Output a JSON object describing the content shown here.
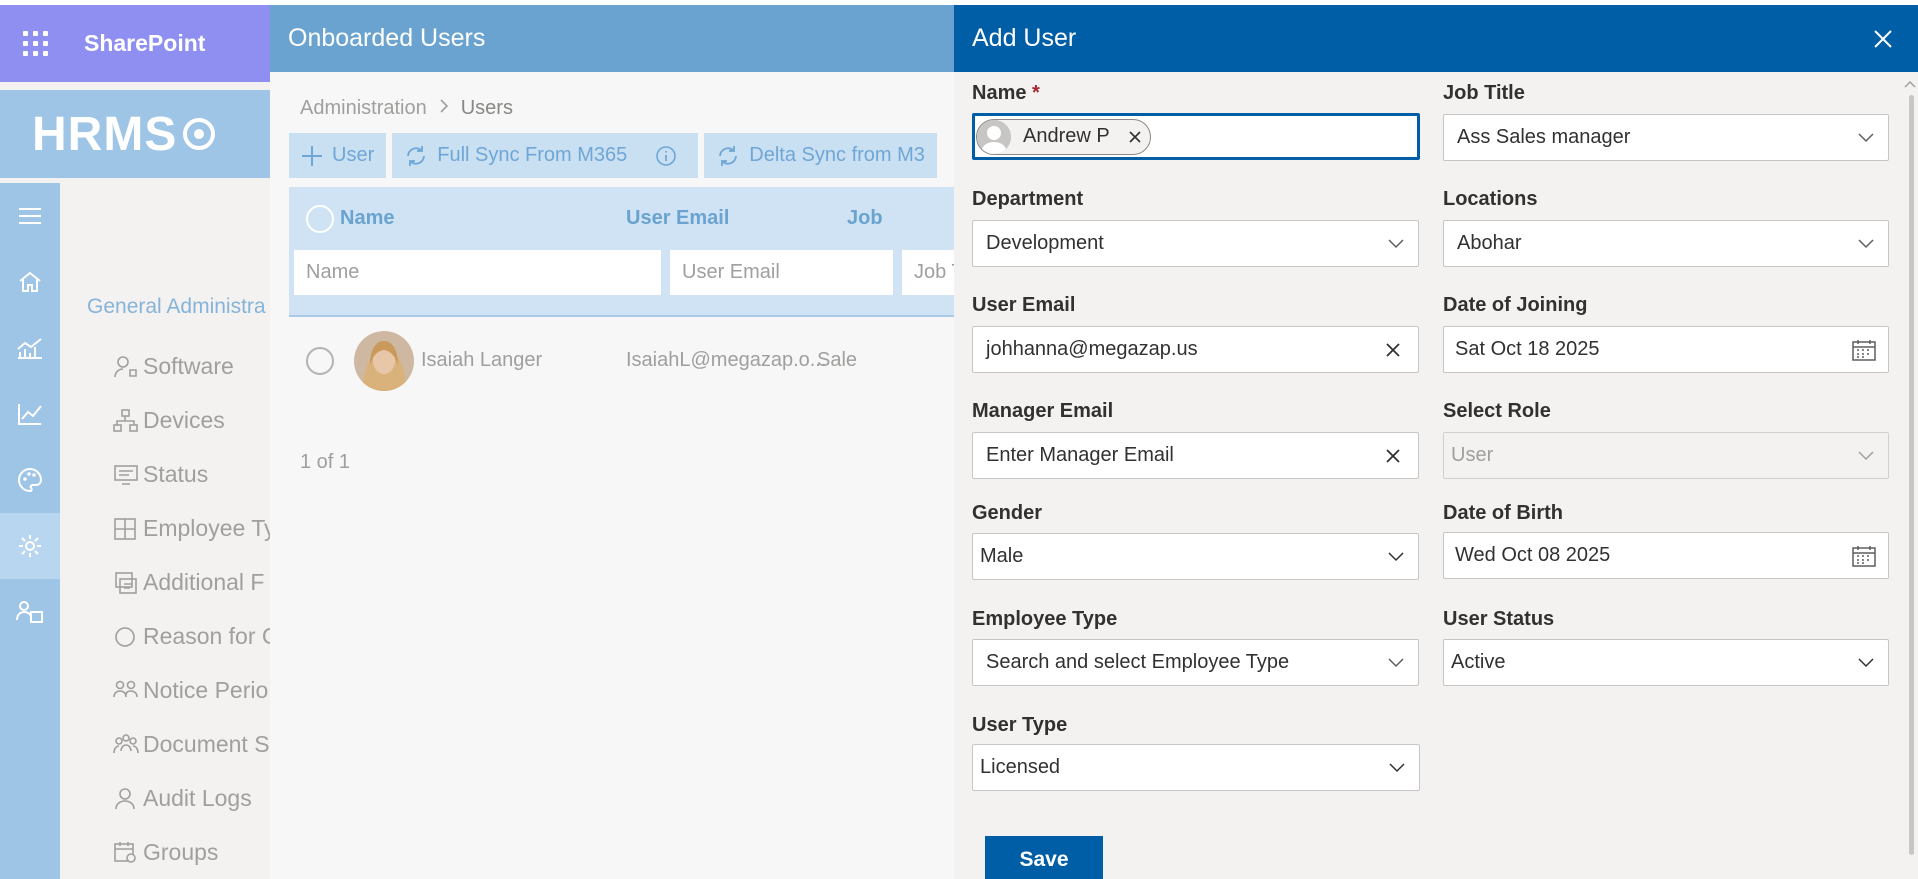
{
  "suite": {
    "title": "SharePoint",
    "waffle_icon": "waffle-icon"
  },
  "hrms": {
    "logo_text": "HRMS"
  },
  "rail": {
    "items": [
      {
        "icon": "menu-icon"
      },
      {
        "icon": "home-icon"
      },
      {
        "icon": "analytics-icon"
      },
      {
        "icon": "line-chart-icon"
      },
      {
        "icon": "palette-icon"
      },
      {
        "icon": "settings-icon",
        "active": true
      },
      {
        "icon": "people-translate-icon"
      }
    ]
  },
  "admin_nav": {
    "header": "General Administra",
    "items": [
      {
        "label": "Software",
        "icon": "user-settings-icon"
      },
      {
        "label": "Devices",
        "icon": "org-chart-icon"
      },
      {
        "label": "Status",
        "icon": "status-board-icon"
      },
      {
        "label": "Employee Ty",
        "icon": "table-grid-icon"
      },
      {
        "label": "Additional F",
        "icon": "fields-icon"
      },
      {
        "label": "Reason for C",
        "icon": "circle-icon"
      },
      {
        "label": "Notice Perio",
        "icon": "group-icon"
      },
      {
        "label": "Document S",
        "icon": "share-people-icon"
      },
      {
        "label": "Audit Logs",
        "icon": "person-icon"
      },
      {
        "label": "Groups",
        "icon": "calendar-group-icon"
      }
    ]
  },
  "users_panel": {
    "title": "Onboarded Users",
    "breadcrumb": {
      "root": "Administration",
      "current": "Users"
    },
    "commands": {
      "add_user": "User",
      "full_sync": "Full Sync From M365",
      "delta_sync": "Delta Sync from M3"
    },
    "grid": {
      "columns": {
        "name": "Name",
        "email": "User Email",
        "job": "Job"
      },
      "filters": {
        "name": "Name",
        "email": "User Email",
        "job": "Job T"
      },
      "rows": [
        {
          "name": "Isaiah Langer",
          "email": "IsaiahL@megazap.o...",
          "job": "Sale"
        }
      ],
      "pager": "1 of 1"
    }
  },
  "add_user": {
    "title": "Add User",
    "fields": {
      "name": {
        "label": "Name",
        "required_mark": "*",
        "persona": "Andrew P"
      },
      "job_title": {
        "label": "Job Title",
        "value": "Ass Sales manager"
      },
      "department": {
        "label": "Department",
        "value": "Development"
      },
      "locations": {
        "label": "Locations",
        "value": "Abohar"
      },
      "user_email": {
        "label": "User Email",
        "value": "johhanna@megazap.us"
      },
      "date_of_joining": {
        "label": "Date of Joining",
        "value": "Sat Oct 18 2025"
      },
      "manager_email": {
        "label": "Manager Email",
        "value": "Enter Manager Email"
      },
      "select_role": {
        "label": "Select Role",
        "value": "User"
      },
      "gender": {
        "label": "Gender",
        "value": "Male"
      },
      "date_of_birth": {
        "label": "Date of Birth",
        "value": "Wed Oct 08 2025"
      },
      "employee_type": {
        "label": "Employee Type",
        "value": "Search and select Employee Type"
      },
      "user_status": {
        "label": "User Status",
        "value": "Active"
      },
      "user_type": {
        "label": "User Type",
        "value": "Licensed"
      }
    },
    "save_label": "Save"
  },
  "colors": {
    "suite_bar": "#8f8ff2",
    "brand_light": "#9ec4e6",
    "users_header": "#6aa3cf",
    "panel_header": "#005ea6",
    "primary_button": "#005ea6",
    "required": "#a4262c"
  }
}
